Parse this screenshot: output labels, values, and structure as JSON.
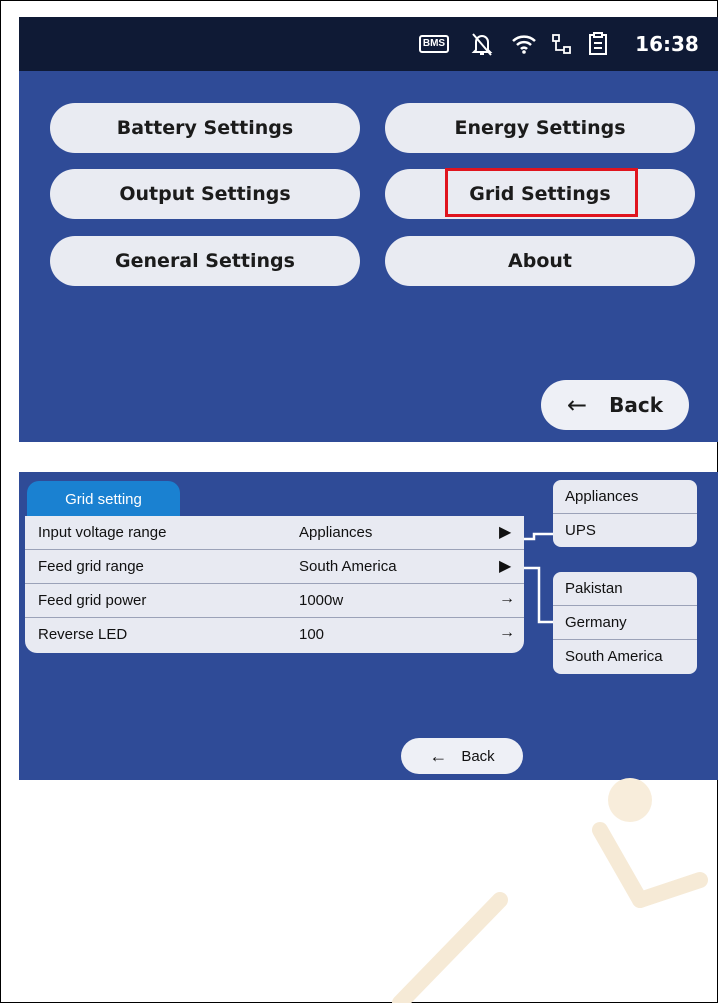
{
  "statusbar": {
    "bms_label": "BMS",
    "icons": [
      "bms-icon",
      "bell-off-icon",
      "wifi-icon",
      "network-icon",
      "clipboard-icon"
    ],
    "time": "16:38"
  },
  "settings_menu": {
    "buttons": [
      {
        "label": "Battery Settings"
      },
      {
        "label": "Energy Settings"
      },
      {
        "label": "Output Settings"
      },
      {
        "label": "Grid Settings",
        "highlighted": true
      },
      {
        "label": "General Settings"
      },
      {
        "label": "About"
      }
    ],
    "back_label": "Back",
    "highlight_color": "#e0141e"
  },
  "grid_setting": {
    "tab_label": "Grid setting",
    "rows": [
      {
        "label": "Input  voltage range",
        "value": "Appliances",
        "action": "▶"
      },
      {
        "label": "Feed grid  range",
        "value": "South America",
        "action": "▶"
      },
      {
        "label": "Feed grid  power",
        "value": "1000w",
        "action": "→"
      },
      {
        "label": "Reverse LED",
        "value": "100",
        "action": "→"
      }
    ],
    "voltage_options": [
      "Appliances",
      "UPS"
    ],
    "region_options": [
      "Pakistan",
      "Germany",
      "South America"
    ],
    "back_label": "Back"
  },
  "colors": {
    "panel_bg": "#2f4b97",
    "statusbar_bg": "#0f1a35",
    "tab_bg": "#1a81d1",
    "pill_bg": "#e9ebf2"
  }
}
